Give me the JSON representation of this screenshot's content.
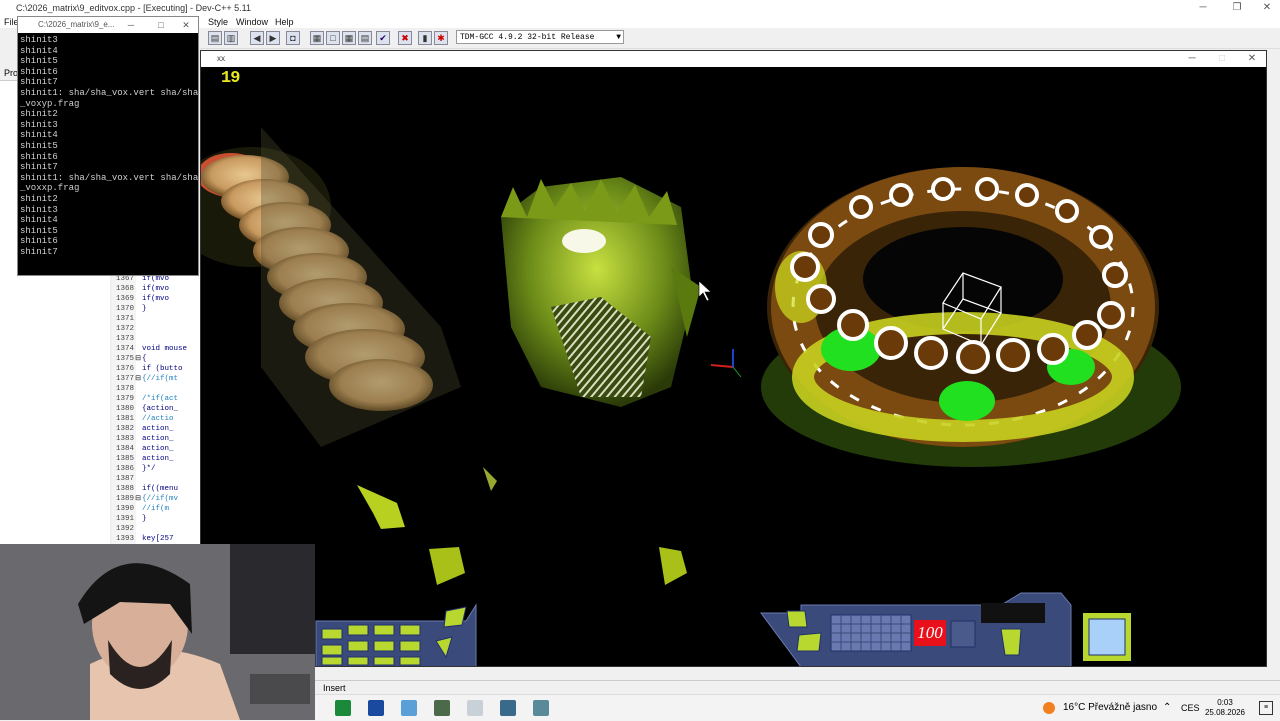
{
  "ide": {
    "title": "C:\\2026_matrix\\9_editvox.cpp - [Executing] - Dev-C++ 5.11",
    "menu": [
      "File",
      "Style",
      "Window",
      "Help"
    ],
    "compiler": "TDM-GCC 4.9.2 32-bit Release",
    "left_tab_label": "Pro",
    "status_mode": "Insert"
  },
  "editor": {
    "lines": [
      {
        "no": "1367",
        "fold": "",
        "code": "if(mvo"
      },
      {
        "no": "1368",
        "fold": "",
        "code": "if(mvo"
      },
      {
        "no": "1369",
        "fold": "",
        "code": "if(mvo"
      },
      {
        "no": "1370",
        "fold": "",
        "code": "}"
      },
      {
        "no": "1371",
        "fold": "",
        "code": ""
      },
      {
        "no": "1372",
        "fold": "",
        "code": ""
      },
      {
        "no": "1373",
        "fold": "",
        "code": ""
      },
      {
        "no": "1374",
        "fold": "",
        "code": "void mouse"
      },
      {
        "no": "1375",
        "fold": "⊟",
        "code": "{"
      },
      {
        "no": "1376",
        "fold": "",
        "code": "if (butto"
      },
      {
        "no": "1377",
        "fold": "⊟",
        "code": "{//if(mt"
      },
      {
        "no": "1378",
        "fold": "",
        "code": ""
      },
      {
        "no": "1379",
        "fold": "",
        "code": "/*if(act"
      },
      {
        "no": "1380",
        "fold": "",
        "code": "{action_"
      },
      {
        "no": "1381",
        "fold": "",
        "code": "//actio"
      },
      {
        "no": "1382",
        "fold": "",
        "code": "action_"
      },
      {
        "no": "1383",
        "fold": "",
        "code": "action_"
      },
      {
        "no": "1384",
        "fold": "",
        "code": "action_"
      },
      {
        "no": "1385",
        "fold": "",
        "code": "action_"
      },
      {
        "no": "1386",
        "fold": "",
        "code": "}*/"
      },
      {
        "no": "1387",
        "fold": "",
        "code": ""
      },
      {
        "no": "1388",
        "fold": "",
        "code": "if((menu"
      },
      {
        "no": "1389",
        "fold": "⊟",
        "code": "{//if(mv"
      },
      {
        "no": "1390",
        "fold": "",
        "code": "//if(m"
      },
      {
        "no": "1391",
        "fold": "",
        "code": "}"
      },
      {
        "no": "1392",
        "fold": "",
        "code": ""
      },
      {
        "no": "1393",
        "fold": "",
        "code": "key[257"
      }
    ]
  },
  "console": {
    "title": "C:\\2026_matrix\\9_e...",
    "lines": [
      "shinit3",
      "shinit4",
      "shinit5",
      "shinit6",
      "shinit7",
      "shinit1: sha/sha_vox.vert sha/sha",
      "_voxyp.frag",
      "shinit2",
      "shinit3",
      "shinit4",
      "shinit5",
      "shinit6",
      "shinit7",
      "shinit1: sha/sha_vox.vert sha/sha",
      "_voxxp.frag",
      "shinit2",
      "shinit3",
      "shinit4",
      "shinit5",
      "shinit6",
      "shinit7"
    ]
  },
  "game": {
    "title": "xx",
    "fps": "19",
    "ammo": "100"
  },
  "taskbar": {
    "weather_temp": "16°C",
    "weather_text": "Převážně jasno",
    "lang": "CES",
    "time": "0:03",
    "date": "25.08.2026"
  },
  "colors": {
    "ammo_bg": "#e8101a",
    "fps": "#e8e820",
    "hud_panel": "#3a4a7a",
    "hud_button": "#b8d830"
  }
}
